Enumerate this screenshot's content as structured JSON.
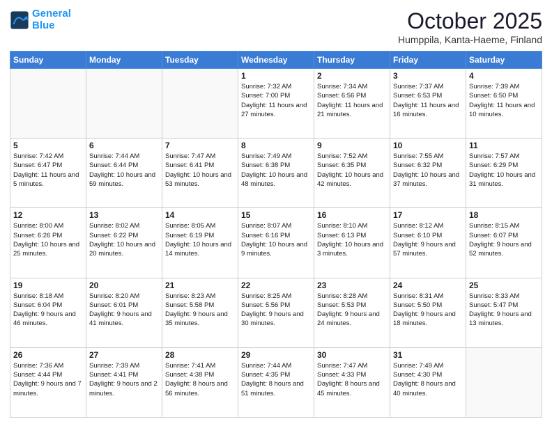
{
  "header": {
    "logo_line1": "General",
    "logo_line2": "Blue",
    "month": "October 2025",
    "location": "Humppila, Kanta-Haeme, Finland"
  },
  "weekdays": [
    "Sunday",
    "Monday",
    "Tuesday",
    "Wednesday",
    "Thursday",
    "Friday",
    "Saturday"
  ],
  "weeks": [
    [
      {
        "day": "",
        "info": ""
      },
      {
        "day": "",
        "info": ""
      },
      {
        "day": "",
        "info": ""
      },
      {
        "day": "1",
        "info": "Sunrise: 7:32 AM\nSunset: 7:00 PM\nDaylight: 11 hours\nand 27 minutes."
      },
      {
        "day": "2",
        "info": "Sunrise: 7:34 AM\nSunset: 6:56 PM\nDaylight: 11 hours\nand 21 minutes."
      },
      {
        "day": "3",
        "info": "Sunrise: 7:37 AM\nSunset: 6:53 PM\nDaylight: 11 hours\nand 16 minutes."
      },
      {
        "day": "4",
        "info": "Sunrise: 7:39 AM\nSunset: 6:50 PM\nDaylight: 11 hours\nand 10 minutes."
      }
    ],
    [
      {
        "day": "5",
        "info": "Sunrise: 7:42 AM\nSunset: 6:47 PM\nDaylight: 11 hours\nand 5 minutes."
      },
      {
        "day": "6",
        "info": "Sunrise: 7:44 AM\nSunset: 6:44 PM\nDaylight: 10 hours\nand 59 minutes."
      },
      {
        "day": "7",
        "info": "Sunrise: 7:47 AM\nSunset: 6:41 PM\nDaylight: 10 hours\nand 53 minutes."
      },
      {
        "day": "8",
        "info": "Sunrise: 7:49 AM\nSunset: 6:38 PM\nDaylight: 10 hours\nand 48 minutes."
      },
      {
        "day": "9",
        "info": "Sunrise: 7:52 AM\nSunset: 6:35 PM\nDaylight: 10 hours\nand 42 minutes."
      },
      {
        "day": "10",
        "info": "Sunrise: 7:55 AM\nSunset: 6:32 PM\nDaylight: 10 hours\nand 37 minutes."
      },
      {
        "day": "11",
        "info": "Sunrise: 7:57 AM\nSunset: 6:29 PM\nDaylight: 10 hours\nand 31 minutes."
      }
    ],
    [
      {
        "day": "12",
        "info": "Sunrise: 8:00 AM\nSunset: 6:26 PM\nDaylight: 10 hours\nand 25 minutes."
      },
      {
        "day": "13",
        "info": "Sunrise: 8:02 AM\nSunset: 6:22 PM\nDaylight: 10 hours\nand 20 minutes."
      },
      {
        "day": "14",
        "info": "Sunrise: 8:05 AM\nSunset: 6:19 PM\nDaylight: 10 hours\nand 14 minutes."
      },
      {
        "day": "15",
        "info": "Sunrise: 8:07 AM\nSunset: 6:16 PM\nDaylight: 10 hours\nand 9 minutes."
      },
      {
        "day": "16",
        "info": "Sunrise: 8:10 AM\nSunset: 6:13 PM\nDaylight: 10 hours\nand 3 minutes."
      },
      {
        "day": "17",
        "info": "Sunrise: 8:12 AM\nSunset: 6:10 PM\nDaylight: 9 hours\nand 57 minutes."
      },
      {
        "day": "18",
        "info": "Sunrise: 8:15 AM\nSunset: 6:07 PM\nDaylight: 9 hours\nand 52 minutes."
      }
    ],
    [
      {
        "day": "19",
        "info": "Sunrise: 8:18 AM\nSunset: 6:04 PM\nDaylight: 9 hours\nand 46 minutes."
      },
      {
        "day": "20",
        "info": "Sunrise: 8:20 AM\nSunset: 6:01 PM\nDaylight: 9 hours\nand 41 minutes."
      },
      {
        "day": "21",
        "info": "Sunrise: 8:23 AM\nSunset: 5:58 PM\nDaylight: 9 hours\nand 35 minutes."
      },
      {
        "day": "22",
        "info": "Sunrise: 8:25 AM\nSunset: 5:56 PM\nDaylight: 9 hours\nand 30 minutes."
      },
      {
        "day": "23",
        "info": "Sunrise: 8:28 AM\nSunset: 5:53 PM\nDaylight: 9 hours\nand 24 minutes."
      },
      {
        "day": "24",
        "info": "Sunrise: 8:31 AM\nSunset: 5:50 PM\nDaylight: 9 hours\nand 18 minutes."
      },
      {
        "day": "25",
        "info": "Sunrise: 8:33 AM\nSunset: 5:47 PM\nDaylight: 9 hours\nand 13 minutes."
      }
    ],
    [
      {
        "day": "26",
        "info": "Sunrise: 7:36 AM\nSunset: 4:44 PM\nDaylight: 9 hours\nand 7 minutes."
      },
      {
        "day": "27",
        "info": "Sunrise: 7:39 AM\nSunset: 4:41 PM\nDaylight: 9 hours\nand 2 minutes."
      },
      {
        "day": "28",
        "info": "Sunrise: 7:41 AM\nSunset: 4:38 PM\nDaylight: 8 hours\nand 56 minutes."
      },
      {
        "day": "29",
        "info": "Sunrise: 7:44 AM\nSunset: 4:35 PM\nDaylight: 8 hours\nand 51 minutes."
      },
      {
        "day": "30",
        "info": "Sunrise: 7:47 AM\nSunset: 4:33 PM\nDaylight: 8 hours\nand 45 minutes."
      },
      {
        "day": "31",
        "info": "Sunrise: 7:49 AM\nSunset: 4:30 PM\nDaylight: 8 hours\nand 40 minutes."
      },
      {
        "day": "",
        "info": ""
      }
    ]
  ]
}
